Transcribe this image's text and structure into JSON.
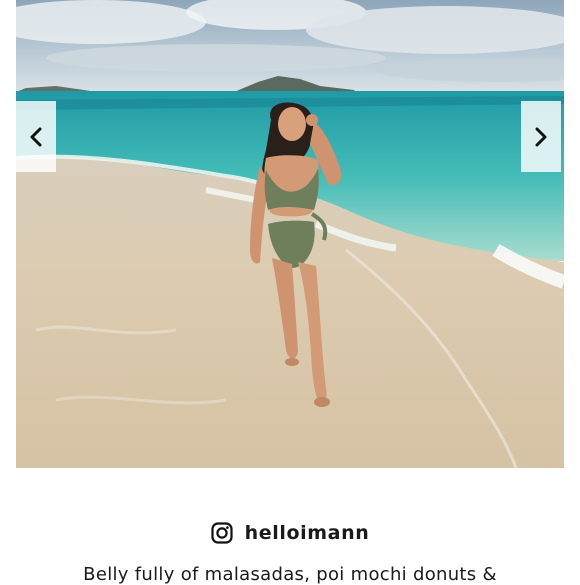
{
  "gallery": {
    "image_alt": "Woman in an olive green one-piece swimsuit walking along a beach",
    "prev_icon": "chevron-left-icon",
    "next_icon": "chevron-right-icon"
  },
  "author": {
    "platform_icon": "instagram-icon",
    "handle": "helloimann"
  },
  "caption": {
    "text": "Belly fully of malasadas, poi mochi donuts &"
  },
  "colors": {
    "swimsuit": "#6f7f5c",
    "ocean": "#3fb3b2",
    "sand": "#ddcdb3",
    "text": "#1a1a1a"
  }
}
